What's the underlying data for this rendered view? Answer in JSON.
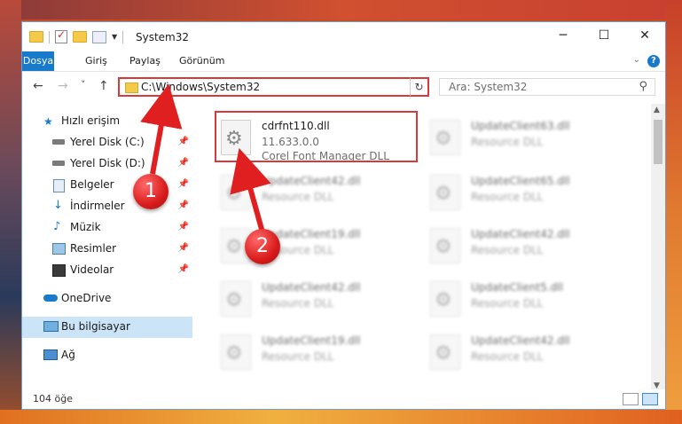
{
  "window": {
    "title": "System32"
  },
  "ribbon": {
    "tabs": [
      "Dosya",
      "Giriş",
      "Paylaş",
      "Görünüm"
    ]
  },
  "window_controls": {
    "minimize": "─",
    "maximize": "☐",
    "close": "✕"
  },
  "navigation": {
    "back": "←",
    "forward": "→",
    "recent": "˅",
    "up": "↑",
    "address": "C:\\Windows\\System32",
    "refresh": "↻",
    "search_placeholder": "Ara: System32"
  },
  "sidebar": {
    "quick_access": "Hızlı erişim",
    "items": [
      {
        "label": "Yerel Disk (C:)",
        "icon": "drive-icon",
        "pinned": true
      },
      {
        "label": "Yerel Disk (D:)",
        "icon": "drive-icon",
        "pinned": true
      },
      {
        "label": "Belgeler",
        "icon": "documents-icon",
        "pinned": true
      },
      {
        "label": "İndirmeler",
        "icon": "download-icon",
        "pinned": true
      },
      {
        "label": "Müzik",
        "icon": "music-icon",
        "pinned": true
      },
      {
        "label": "Resimler",
        "icon": "pictures-icon",
        "pinned": true
      },
      {
        "label": "Videolar",
        "icon": "videos-icon",
        "pinned": true
      }
    ],
    "onedrive": "OneDrive",
    "this_pc": "Bu bilgisayar",
    "network": "Ağ"
  },
  "files": [
    {
      "name": "cdrfnt110.dll",
      "version": "11.633.0.0",
      "desc": "Corel Font Manager DLL"
    },
    {
      "name": "UpdateClient63.dll",
      "desc": "Resource DLL"
    },
    {
      "name": "UpdateClient42.dll",
      "desc": "Resource DLL"
    },
    {
      "name": "UpdateClient65.dll",
      "desc": "Resource DLL"
    },
    {
      "name": "UpdateClient19.dll",
      "desc": "Resource DLL"
    },
    {
      "name": "UpdateClient42.dll",
      "desc": "Resource DLL"
    },
    {
      "name": "UpdateClient42.dll",
      "desc": "Resource DLL"
    },
    {
      "name": "UpdateClient5.dll",
      "desc": "Resource DLL"
    },
    {
      "name": "UpdateClient19.dll",
      "desc": "Resource DLL"
    },
    {
      "name": "UpdateClient42.dll",
      "desc": "Resource DLL"
    }
  ],
  "status": {
    "count": "104 öğe"
  },
  "callouts": [
    "1",
    "2"
  ],
  "colors": {
    "accent": "#1979ca",
    "highlight": "#d63a3a",
    "selected": "#cce4f7"
  }
}
